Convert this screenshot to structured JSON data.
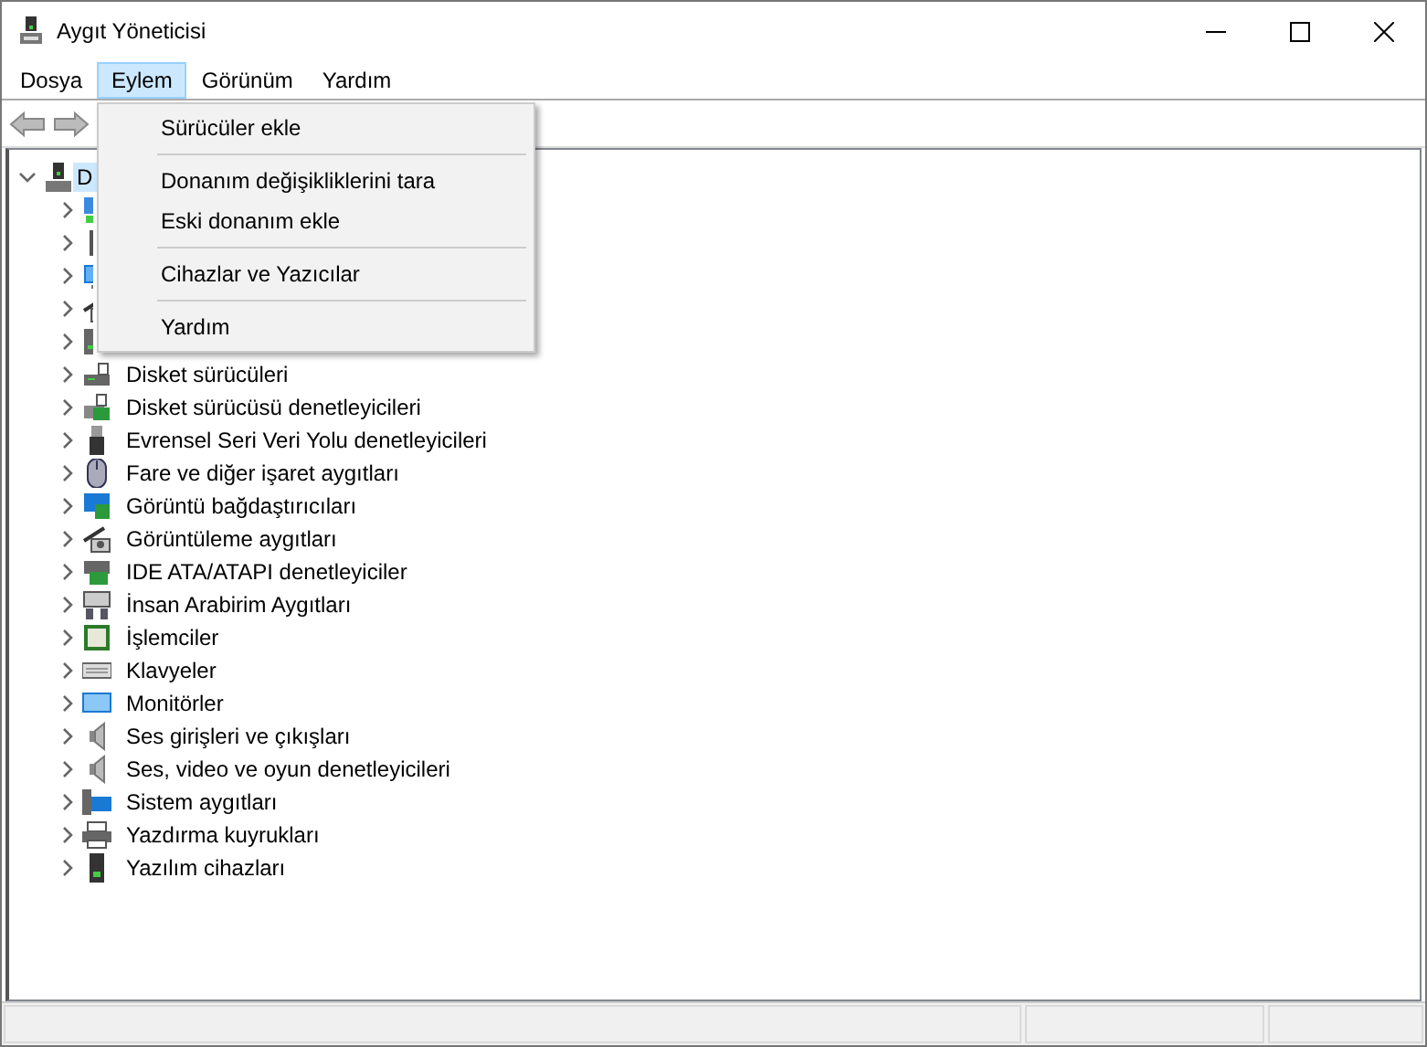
{
  "window": {
    "title": "Aygıt Yöneticisi"
  },
  "menu_bar": [
    {
      "label": "Dosya",
      "selected": false
    },
    {
      "label": "Eylem",
      "selected": true
    },
    {
      "label": "Görünüm",
      "selected": false
    },
    {
      "label": "Yardım",
      "selected": false
    }
  ],
  "open_menu": {
    "groups": [
      [
        "Sürücüler ekle"
      ],
      [
        "Donanım değişikliklerini tara",
        "Eski donanım ekle"
      ],
      [
        "Cihazlar ve Yazıcılar"
      ],
      [
        "Yardım"
      ]
    ]
  },
  "tree": {
    "label": "D",
    "selected": true,
    "expanded": true,
    "children": [
      {
        "expanded": false
      },
      {
        "expanded": false
      },
      {
        "expanded": false
      },
      {
        "expanded": false
      },
      {
        "expanded": false
      },
      {
        "label": "Disket sürücüleri",
        "selected": false,
        "expanded": false
      },
      {
        "label": "Disket sürücüsü denetleyicileri",
        "selected": false,
        "expanded": false
      },
      {
        "label": "Evrensel Seri Veri Yolu denetleyicileri",
        "selected": false,
        "expanded": false
      },
      {
        "label": "Fare ve diğer işaret aygıtları",
        "selected": false,
        "expanded": false
      },
      {
        "label": "Görüntü bağdaştırıcıları",
        "selected": false,
        "expanded": false
      },
      {
        "label": "Görüntüleme aygıtları",
        "selected": false,
        "expanded": false
      },
      {
        "label": "IDE ATA/ATAPI denetleyiciler",
        "selected": false,
        "expanded": false
      },
      {
        "label": "İnsan Arabirim Aygıtları",
        "selected": false,
        "expanded": false
      },
      {
        "label": "İşlemciler",
        "selected": false,
        "expanded": false
      },
      {
        "label": "Klavyeler",
        "selected": false,
        "expanded": false
      },
      {
        "label": "Monitörler",
        "selected": false,
        "expanded": false
      },
      {
        "label": "Ses girişleri ve çıkışları",
        "selected": false,
        "expanded": false
      },
      {
        "label": "Ses, video ve oyun denetleyicileri",
        "selected": false,
        "expanded": false
      },
      {
        "label": "Sistem aygıtları",
        "selected": false,
        "expanded": false
      },
      {
        "label": "Yazdırma kuyrukları",
        "selected": false,
        "expanded": false
      },
      {
        "label": "Yazılım cihazları",
        "selected": false,
        "expanded": false
      }
    ]
  }
}
